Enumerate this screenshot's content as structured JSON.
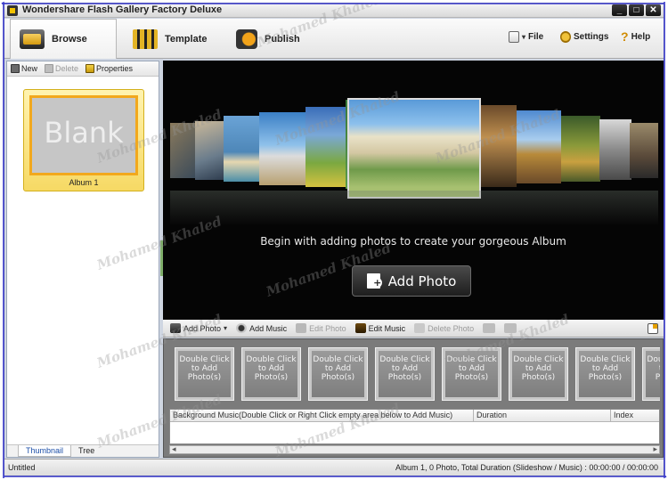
{
  "window": {
    "title": "Wondershare Flash Gallery Factory Deluxe",
    "buttons": [
      "_",
      "□",
      "✕"
    ]
  },
  "modes": {
    "browse": "Browse",
    "template": "Template",
    "publish": "Publish"
  },
  "menu": {
    "file": "File",
    "settings": "Settings",
    "help": "Help"
  },
  "album_panel": {
    "toolbar": {
      "new": "New",
      "delete": "Delete",
      "properties": "Properties"
    },
    "albums": [
      {
        "thumb_text": "Blank",
        "name": "Album 1"
      }
    ],
    "tabs": {
      "thumbnail": "Thumbnail",
      "tree": "Tree"
    }
  },
  "stage": {
    "caption": "Begin with adding photos to create your gorgeous Album",
    "add_photo_button": "Add Photo"
  },
  "storyboard_toolbar": {
    "add_photo": "Add Photo",
    "add_music": "Add Music",
    "edit_photo": "Edit Photo",
    "edit_music": "Edit Music",
    "delete_photo": "Delete Photo"
  },
  "storyboard": {
    "slot_label": "Double Click to Add Photo(s)",
    "slot_count_visible": 8,
    "music_columns": {
      "background": "Background Music(Double Click or Right Click empty area below to Add Music)",
      "duration": "Duration",
      "index": "Index"
    }
  },
  "status": {
    "left": "Untitled",
    "right": "Album 1, 0 Photo, Total Duration (Slideshow / Music) : 00:00:00 / 00:00:00"
  },
  "watermark": "Mohamed Khaled",
  "colors": {
    "accent_yellow": "#f2a81c",
    "stage_bg": "#050505",
    "frame_border": "#3a3acc"
  }
}
